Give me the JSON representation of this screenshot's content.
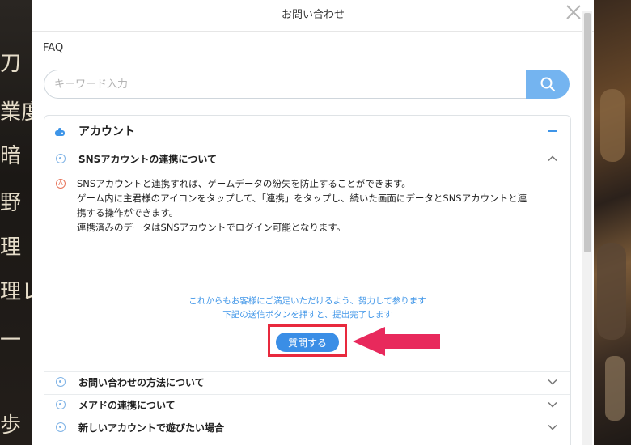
{
  "background": {
    "left_glyphs": [
      "刀",
      "業度",
      "暗",
      "野",
      "理",
      "理レベ",
      "一",
      "歩"
    ]
  },
  "modal": {
    "title": "お問い合わせ",
    "faq_label": "FAQ",
    "search": {
      "placeholder": "キーワード入力"
    },
    "category": {
      "title": "アカウント"
    },
    "open_question": {
      "title": "SNSアカウントの連携について",
      "answer_lines": [
        "SNSアカウントと連携すれば、ゲームデータの紛失を防止することができます。",
        "ゲーム内に主君様のアイコンをタップして、「連携」をタップし、続いた画面にデータとSNSアカウントと連",
        "携する操作ができます。",
        "連携済みのデータはSNSアカウントでログイン可能となります。"
      ]
    },
    "notice_lines": [
      "これからもお客様にご満足いただけるよう、努力して参ります",
      "下記の送信ボタンを押すと、提出完了します"
    ],
    "ask_button": "質問する",
    "other_questions": [
      "お問い合わせの方法について",
      "メアドの連携について",
      "新しいアカウントで遊びたい場合"
    ]
  },
  "colors": {
    "accent": "#3a8ee6",
    "search_button": "#74b4f0",
    "highlight": "#e8293d",
    "arrow": "#e8295c"
  }
}
